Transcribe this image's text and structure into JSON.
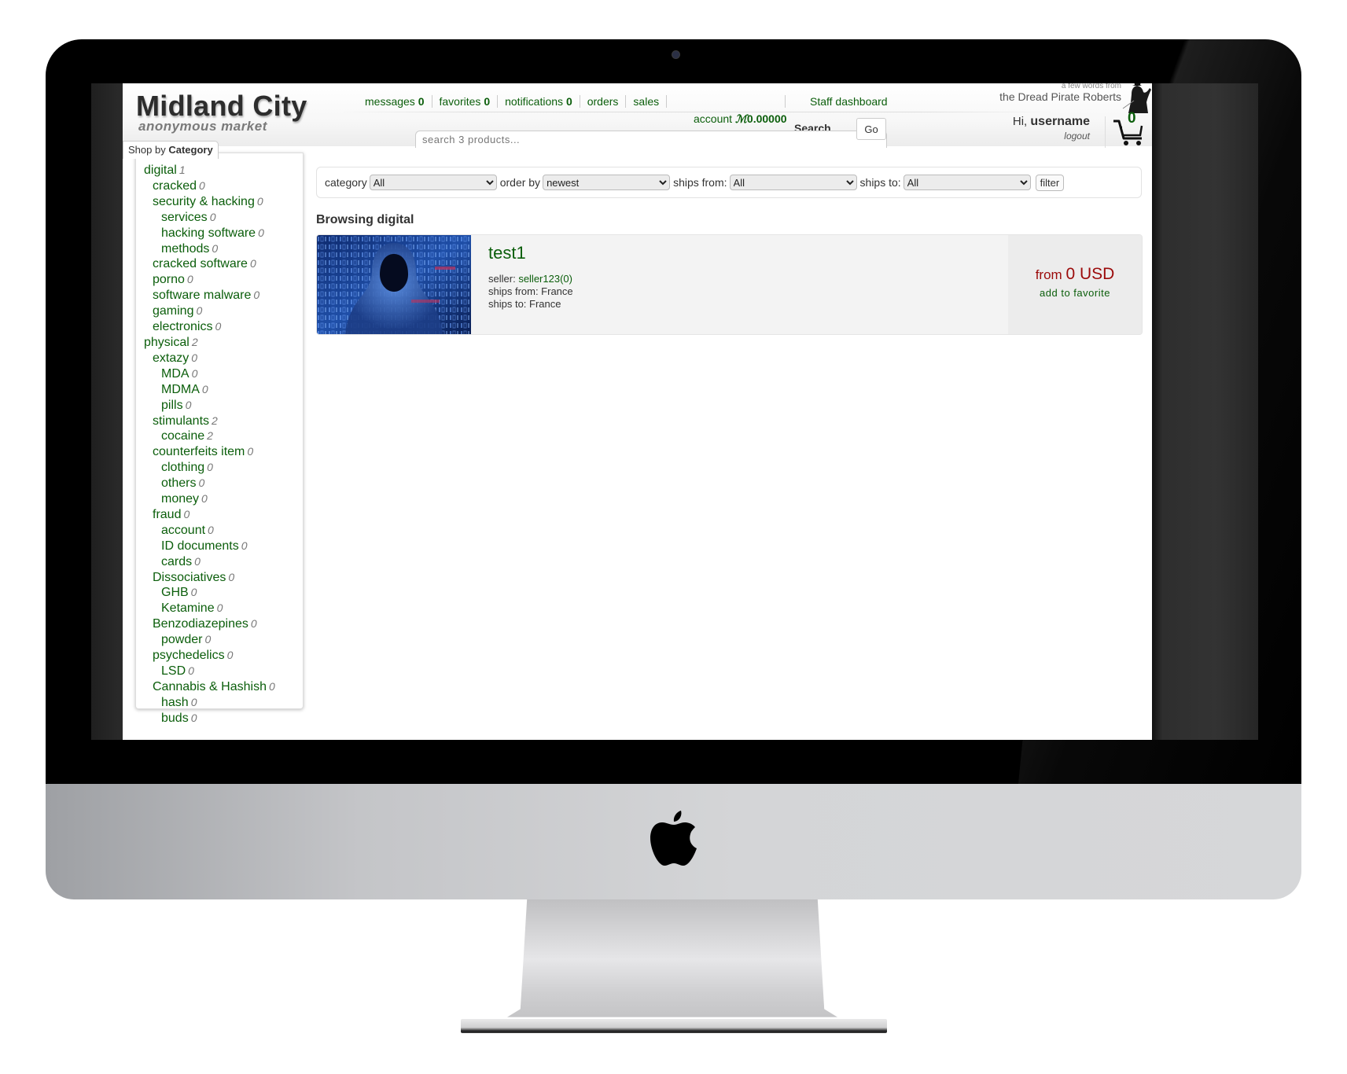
{
  "site": {
    "title": "Midland City",
    "subtitle": "anonymous market"
  },
  "nav": {
    "items": [
      {
        "label": "messages",
        "count": "0"
      },
      {
        "label": "favorites",
        "count": "0"
      },
      {
        "label": "notifications",
        "count": "0"
      },
      {
        "label": "orders",
        "count": ""
      },
      {
        "label": "sales",
        "count": ""
      }
    ],
    "staff_dashboard": "Staff dashboard"
  },
  "account": {
    "label": "account",
    "currency_symbol": "ℳ",
    "balance": "0.00000"
  },
  "search": {
    "label": "Search",
    "placeholder": "search 3 products...",
    "value": "",
    "go_label": "Go"
  },
  "dpr": {
    "small": "a few words from",
    "line": "the Dread Pirate Roberts"
  },
  "user": {
    "greeting": "Hi,",
    "username": "username",
    "logout_label": "logout",
    "cart_count": "0"
  },
  "sidebar": {
    "tab_prefix": "Shop by",
    "tab_bold": "Category",
    "categories": [
      {
        "label": "digital",
        "count": "1",
        "level": 0
      },
      {
        "label": "cracked",
        "count": "0",
        "level": 1
      },
      {
        "label": "security & hacking",
        "count": "0",
        "level": 1
      },
      {
        "label": "services",
        "count": "0",
        "level": 2
      },
      {
        "label": "hacking software",
        "count": "0",
        "level": 2
      },
      {
        "label": "methods",
        "count": "0",
        "level": 2
      },
      {
        "label": "cracked software",
        "count": "0",
        "level": 1
      },
      {
        "label": "porno",
        "count": "0",
        "level": 1
      },
      {
        "label": "software malware",
        "count": "0",
        "level": 1
      },
      {
        "label": "gaming",
        "count": "0",
        "level": 1
      },
      {
        "label": "electronics",
        "count": "0",
        "level": 1
      },
      {
        "label": "physical",
        "count": "2",
        "level": 0
      },
      {
        "label": "extazy",
        "count": "0",
        "level": 1
      },
      {
        "label": "MDA",
        "count": "0",
        "level": 2
      },
      {
        "label": "MDMA",
        "count": "0",
        "level": 2
      },
      {
        "label": "pills",
        "count": "0",
        "level": 2
      },
      {
        "label": "stimulants",
        "count": "2",
        "level": 1
      },
      {
        "label": "cocaine",
        "count": "2",
        "level": 2
      },
      {
        "label": "counterfeits item",
        "count": "0",
        "level": 1
      },
      {
        "label": "clothing",
        "count": "0",
        "level": 2
      },
      {
        "label": "others",
        "count": "0",
        "level": 2
      },
      {
        "label": "money",
        "count": "0",
        "level": 2
      },
      {
        "label": "fraud",
        "count": "0",
        "level": 1
      },
      {
        "label": "account",
        "count": "0",
        "level": 2
      },
      {
        "label": "ID documents",
        "count": "0",
        "level": 2
      },
      {
        "label": "cards",
        "count": "0",
        "level": 2
      },
      {
        "label": "Dissociatives",
        "count": "0",
        "level": 1
      },
      {
        "label": "GHB",
        "count": "0",
        "level": 2
      },
      {
        "label": "Ketamine",
        "count": "0",
        "level": 2
      },
      {
        "label": "Benzodiazepines",
        "count": "0",
        "level": 1
      },
      {
        "label": "powder",
        "count": "0",
        "level": 2
      },
      {
        "label": "psychedelics",
        "count": "0",
        "level": 1
      },
      {
        "label": "LSD",
        "count": "0",
        "level": 2
      },
      {
        "label": "Cannabis & Hashish",
        "count": "0",
        "level": 1
      },
      {
        "label": "hash",
        "count": "0",
        "level": 2
      },
      {
        "label": "buds",
        "count": "0",
        "level": 2
      }
    ]
  },
  "filters": {
    "category_label": "category",
    "category_value": "All",
    "order_label": "order by",
    "order_value": "newest",
    "ships_from_label": "ships from:",
    "ships_from_value": "All",
    "ships_to_label": "ships to:",
    "ships_to_value": "All",
    "filter_button": "filter"
  },
  "listing": {
    "heading": "Browsing digital",
    "products": [
      {
        "title": "test1",
        "seller_label": "seller:",
        "seller": "seller123(0)",
        "ships_from": "ships from: France",
        "ships_to": "ships to: France",
        "price_prefix": "from",
        "price": "0 USD",
        "favorite_label": "add to favorite",
        "image": "hooded-hacker-binary"
      }
    ]
  }
}
